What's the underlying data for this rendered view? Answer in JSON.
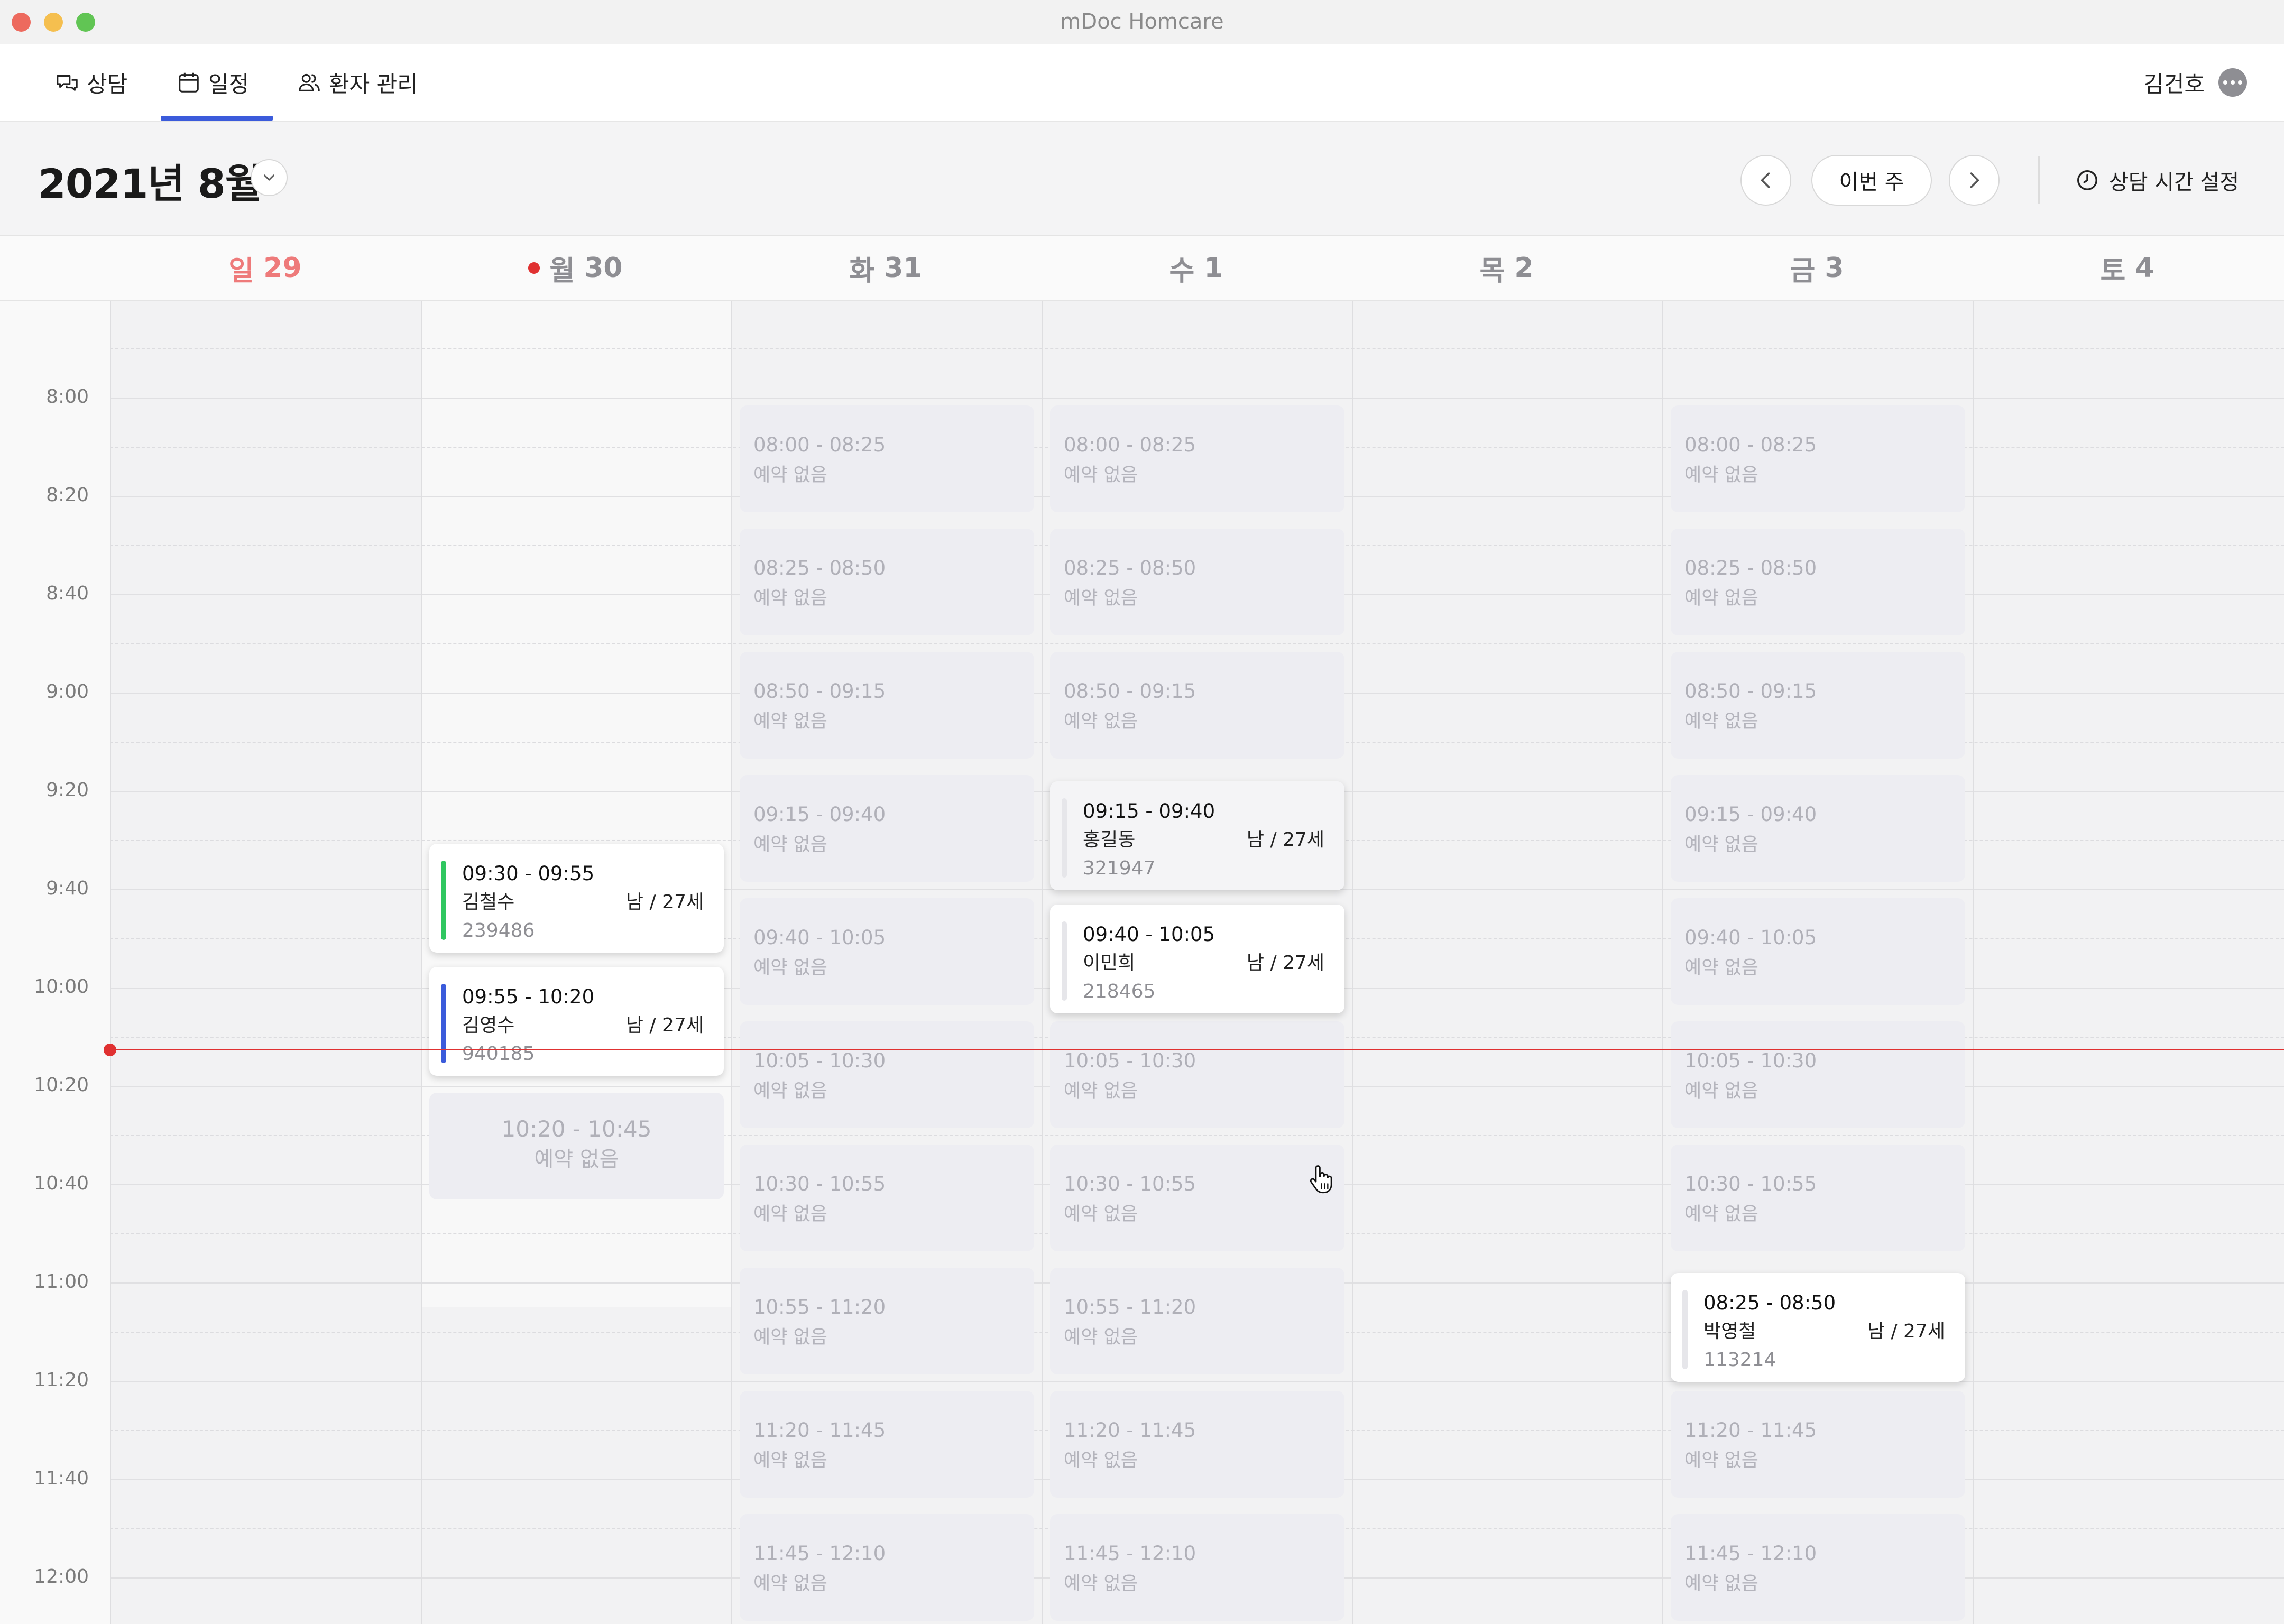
{
  "window": {
    "title": "mDoc Homcare"
  },
  "nav": {
    "tabs": [
      {
        "label": "상담",
        "icon": "chat-icon"
      },
      {
        "label": "일정",
        "icon": "calendar-icon",
        "active": true
      },
      {
        "label": "환자 관리",
        "icon": "users-icon"
      }
    ],
    "user_name": "김건호"
  },
  "toolbar": {
    "month_title": "2021년 8월",
    "this_week_label": "이번 주",
    "settings_label": "상담 시간 설정"
  },
  "days": [
    {
      "weekday": "일",
      "date": "29"
    },
    {
      "weekday": "월",
      "date": "30",
      "today": true
    },
    {
      "weekday": "화",
      "date": "31"
    },
    {
      "weekday": "수",
      "date": "1"
    },
    {
      "weekday": "목",
      "date": "2"
    },
    {
      "weekday": "금",
      "date": "3"
    },
    {
      "weekday": "토",
      "date": "4"
    }
  ],
  "time_labels": [
    "8:00",
    "8:20",
    "8:40",
    "9:00",
    "9:20",
    "9:40",
    "10:00",
    "10:20",
    "10:40",
    "11:00",
    "11:20",
    "11:40",
    "12:00"
  ],
  "empty_status": "예약 없음",
  "slot_times": [
    "08:00 - 08:25",
    "08:25 - 08:50",
    "08:50 - 09:15",
    "09:15 - 09:40",
    "09:40 - 10:05",
    "10:05 - 10:30",
    "10:30 - 10:55",
    "10:55 - 11:20",
    "11:20 - 11:45",
    "11:45 - 12:10"
  ],
  "monday_empty_slot": {
    "time": "10:20 - 10:45",
    "status": "예약 없음"
  },
  "appointments": [
    {
      "time": "09:30 - 09:55",
      "name": "김철수",
      "gender_age": "남 / 27세",
      "patient_id": "239486"
    },
    {
      "time": "09:55 - 10:20",
      "name": "김영수",
      "gender_age": "남 / 27세",
      "patient_id": "940185"
    },
    {
      "time": "09:15 - 09:40",
      "name": "홍길동",
      "gender_age": "남 / 27세",
      "patient_id": "321947"
    },
    {
      "time": "09:40 - 10:05",
      "name": "이민희",
      "gender_age": "남 / 27세",
      "patient_id": "218465"
    },
    {
      "time": "08:25 - 08:50",
      "name": "박영철",
      "gender_age": "남 / 27세",
      "patient_id": "113214"
    }
  ],
  "colors": {
    "accent": "#3b5bdb",
    "today_dot": "#e03131",
    "sunday": "#ee7a7a",
    "appt_green": "#2fc760",
    "appt_blue": "#3b5bdb",
    "appt_neutral": "#e6e6ea"
  }
}
